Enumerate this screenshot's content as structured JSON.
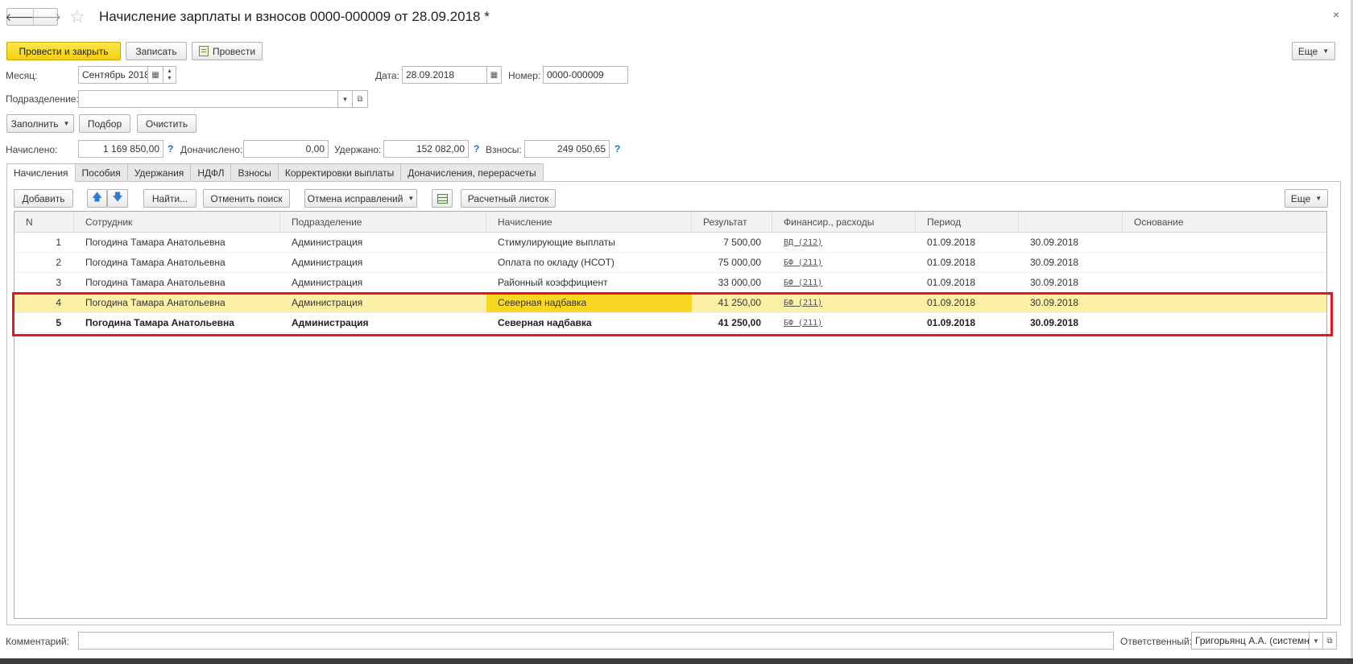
{
  "window": {
    "title": "Начисление зарплаты и взносов 0000-000009 от 28.09.2018 *",
    "close_label": "×"
  },
  "toolbar": {
    "post_close": "Провести и закрыть",
    "save": "Записать",
    "post": "Провести",
    "more": "Еще"
  },
  "header": {
    "month_label": "Месяц:",
    "month_value": "Сентябрь 2018",
    "date_label": "Дата:",
    "date_value": "28.09.2018",
    "number_label": "Номер:",
    "number_value": "0000-000009",
    "dept_label": "Подразделение:",
    "dept_value": ""
  },
  "actions": {
    "fill": "Заполнить",
    "pick": "Подбор",
    "clear": "Очистить"
  },
  "totals": {
    "accrued_label": "Начислено:",
    "accrued_value": "1 169 850,00",
    "extra_label": "Доначислено:",
    "extra_value": "0,00",
    "withheld_label": "Удержано:",
    "withheld_value": "152 082,00",
    "contrib_label": "Взносы:",
    "contrib_value": "249 050,65",
    "help": "?"
  },
  "tabs": [
    "Начисления",
    "Пособия",
    "Удержания",
    "НДФЛ",
    "Взносы",
    "Корректировки выплаты",
    "Доначисления, перерасчеты"
  ],
  "table_toolbar": {
    "add": "Добавить",
    "find": "Найти...",
    "cancel_search": "Отменить поиск",
    "cancel_fix": "Отмена исправлений",
    "payslip": "Расчетный листок",
    "more": "Еще"
  },
  "columns": {
    "n": "N",
    "employee": "Сотрудник",
    "dept": "Подразделение",
    "accrual": "Начисление",
    "result": "Результат",
    "finance": "Финансир., расходы",
    "period": "Период",
    "period_end": "",
    "basis": "Основание"
  },
  "rows": [
    {
      "n": "1",
      "employee": "Погодина Тамара Анатольевна",
      "dept": "Администрация",
      "accrual": "Стимулирующие выплаты",
      "result": "7 500,00",
      "finance": "ВД (212)",
      "period_from": "01.09.2018",
      "period_to": "30.09.2018",
      "basis": ""
    },
    {
      "n": "2",
      "employee": "Погодина Тамара Анатольевна",
      "dept": "Администрация",
      "accrual": "Оплата по окладу (НСОТ)",
      "result": "75 000,00",
      "finance": "БФ (211)",
      "period_from": "01.09.2018",
      "period_to": "30.09.2018",
      "basis": ""
    },
    {
      "n": "3",
      "employee": "Погодина Тамара Анатольевна",
      "dept": "Администрация",
      "accrual": "Районный коэффициент",
      "result": "33 000,00",
      "finance": "БФ (211)",
      "period_from": "01.09.2018",
      "period_to": "30.09.2018",
      "basis": ""
    },
    {
      "n": "4",
      "employee": "Погодина Тамара Анатольевна",
      "dept": "Администрация",
      "accrual": "Северная надбавка",
      "result": "41 250,00",
      "finance": "БФ (211)",
      "period_from": "01.09.2018",
      "period_to": "30.09.2018",
      "basis": ""
    },
    {
      "n": "5",
      "employee": "Погодина Тамара Анатольевна",
      "dept": "Администрация",
      "accrual": "Северная надбавка",
      "result": "41 250,00",
      "finance": "БФ (211)",
      "period_from": "01.09.2018",
      "period_to": "30.09.2018",
      "basis": ""
    }
  ],
  "footer": {
    "comment_label": "Комментарий:",
    "comment_value": "",
    "responsible_label": "Ответственный:",
    "responsible_value": "Григорьянц А.А. (системн"
  },
  "colors": {
    "primary_button": "#f5cf12",
    "selected_row": "#fbf0a6",
    "selected_cell": "#f9d825",
    "annotation_box": "#e8141f",
    "help_link": "#1c6cc9"
  }
}
